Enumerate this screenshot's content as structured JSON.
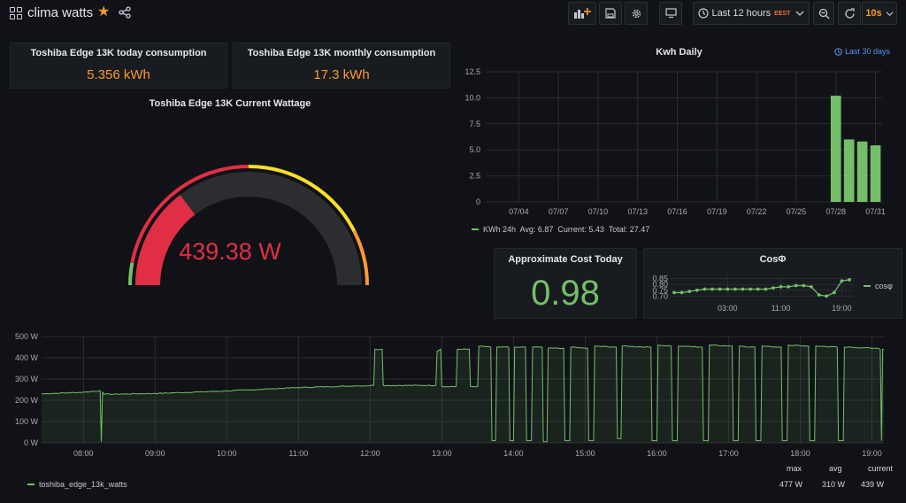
{
  "dashboard": {
    "title": "clima watts"
  },
  "toolbar": {
    "time_range": "Last 12 hours",
    "timezone": "EEST",
    "refresh_interval": "10s"
  },
  "panels": {
    "today": {
      "title": "Toshiba Edge 13K today consumption",
      "value": "5.356 kWh"
    },
    "monthly": {
      "title": "Toshiba Edge 13K monthly consumption",
      "value": "17.3 kWh"
    },
    "gauge": {
      "title": "Toshiba Edge 13K Current Wattage",
      "value": "439.38 W",
      "level": 439.38,
      "max": 1500
    },
    "kwh_daily": {
      "title": "Kwh Daily",
      "time_override": "Last 30 days",
      "legend": "KWh 24h  Avg: 6.87  Current: 5.43  Total: 27.47"
    },
    "cost": {
      "title": "Approximate Cost Today",
      "value": "0.98"
    },
    "cosphi": {
      "title": "CosΦ",
      "legend": "cosφ"
    },
    "watts": {
      "legend": "toshiba_edge_13k_watts",
      "stats_headers": [
        "max",
        "avg",
        "current"
      ],
      "stats_values": [
        "477 W",
        "310 W",
        "439 W"
      ]
    }
  },
  "colors": {
    "green": "#73bf69",
    "red": "#e02f44",
    "orange": "#ff9830",
    "yellow": "#fade2a",
    "blue": "#33a2e5"
  },
  "chart_data": [
    {
      "type": "bar",
      "title": "Kwh Daily",
      "categories": [
        "07/04",
        "07/07",
        "07/10",
        "07/13",
        "07/16",
        "07/19",
        "07/22",
        "07/25",
        "07/28",
        "07/31"
      ],
      "x_ticks": [
        "07/04",
        "07/07",
        "07/10",
        "07/13",
        "07/16",
        "07/19",
        "07/22",
        "07/25",
        "07/28",
        "07/31"
      ],
      "y_ticks": [
        "0",
        "2.5",
        "5.0",
        "7.5",
        "10.0",
        "12.5"
      ],
      "ylim": [
        0,
        12.5
      ],
      "series": [
        {
          "name": "KWh 24h",
          "dates": [
            "07/28",
            "07/29",
            "07/30",
            "07/31"
          ],
          "values": [
            10.2,
            6.0,
            5.8,
            5.43
          ]
        }
      ]
    },
    {
      "type": "line",
      "title": "CosΦ",
      "y_ticks": [
        "0.85",
        "0.80",
        "0.75",
        "0.70"
      ],
      "ylim": [
        0.68,
        0.87
      ],
      "x_ticks": [
        "03:00",
        "11:00",
        "19:00"
      ],
      "series": [
        {
          "name": "cosφ",
          "values": [
            0.73,
            0.73,
            0.74,
            0.75,
            0.76,
            0.76,
            0.76,
            0.76,
            0.76,
            0.76,
            0.76,
            0.76,
            0.76,
            0.77,
            0.78,
            0.78,
            0.79,
            0.79,
            0.78,
            0.71,
            0.7,
            0.73,
            0.83,
            0.84
          ]
        }
      ]
    },
    {
      "type": "area",
      "title": "",
      "y_ticks": [
        "0 W",
        "100 W",
        "200 W",
        "300 W",
        "400 W",
        "500 W"
      ],
      "ylim": [
        0,
        500
      ],
      "x_ticks": [
        "08:00",
        "09:00",
        "10:00",
        "11:00",
        "12:00",
        "13:00",
        "14:00",
        "15:00",
        "16:00",
        "17:00",
        "18:00",
        "19:00"
      ],
      "series": [
        {
          "name": "toshiba_edge_13k_watts",
          "points": [
            [
              "07:25",
              230
            ],
            [
              "08:00",
              238
            ],
            [
              "08:14",
              245
            ],
            [
              "08:15",
              5
            ],
            [
              "08:16",
              240
            ],
            [
              "08:17",
              228
            ],
            [
              "09:00",
              232
            ],
            [
              "10:00",
              244
            ],
            [
              "11:00",
              260
            ],
            [
              "11:50",
              268
            ],
            [
              "12:03",
              270
            ],
            [
              "12:04",
              440
            ],
            [
              "12:10",
              440
            ],
            [
              "12:11",
              270
            ],
            [
              "12:55",
              270
            ],
            [
              "12:56",
              430
            ],
            [
              "12:59",
              440
            ],
            [
              "13:00",
              265
            ],
            [
              "13:12",
              265
            ],
            [
              "13:13",
              440
            ],
            [
              "13:23",
              440
            ],
            [
              "13:24",
              265
            ],
            [
              "13:30",
              265
            ],
            [
              "13:31",
              455
            ],
            [
              "13:41",
              450
            ],
            [
              "13:42",
              10
            ],
            [
              "13:45",
              10
            ],
            [
              "13:46",
              450
            ],
            [
              "13:56",
              450
            ],
            [
              "13:57",
              10
            ],
            [
              "14:00",
              10
            ],
            [
              "14:01",
              450
            ],
            [
              "14:10",
              450
            ],
            [
              "14:11",
              10
            ],
            [
              "14:15",
              10
            ],
            [
              "14:16",
              450
            ],
            [
              "14:24",
              450
            ],
            [
              "14:25",
              5
            ],
            [
              "14:28",
              5
            ],
            [
              "14:29",
              445
            ],
            [
              "14:42",
              445
            ],
            [
              "14:43",
              10
            ],
            [
              "14:47",
              10
            ],
            [
              "14:48",
              450
            ],
            [
              "15:00",
              445
            ],
            [
              "15:02",
              445
            ],
            [
              "15:03",
              10
            ],
            [
              "15:07",
              10
            ],
            [
              "15:08",
              455
            ],
            [
              "15:26",
              450
            ],
            [
              "15:27",
              20
            ],
            [
              "15:30",
              20
            ],
            [
              "15:31",
              455
            ],
            [
              "15:55",
              450
            ],
            [
              "15:56",
              10
            ],
            [
              "16:00",
              10
            ],
            [
              "16:01",
              460
            ],
            [
              "16:12",
              455
            ],
            [
              "16:13",
              10
            ],
            [
              "16:17",
              10
            ],
            [
              "16:18",
              455
            ],
            [
              "16:38",
              450
            ],
            [
              "16:39",
              10
            ],
            [
              "16:43",
              10
            ],
            [
              "16:44",
              460
            ],
            [
              "17:03",
              455
            ],
            [
              "17:04",
              10
            ],
            [
              "17:08",
              10
            ],
            [
              "17:09",
              455
            ],
            [
              "17:22",
              450
            ],
            [
              "17:23",
              10
            ],
            [
              "17:27",
              10
            ],
            [
              "17:28",
              455
            ],
            [
              "17:44",
              450
            ],
            [
              "17:45",
              10
            ],
            [
              "17:49",
              10
            ],
            [
              "17:50",
              460
            ],
            [
              "18:07",
              455
            ],
            [
              "18:08",
              10
            ],
            [
              "18:12",
              10
            ],
            [
              "18:13",
              455
            ],
            [
              "18:31",
              450
            ],
            [
              "18:32",
              10
            ],
            [
              "18:36",
              10
            ],
            [
              "18:37",
              450
            ],
            [
              "19:05",
              445
            ],
            [
              "19:07",
              440
            ],
            [
              "19:08",
              10
            ],
            [
              "19:09",
              440
            ],
            [
              "19:10",
              439
            ]
          ]
        }
      ]
    }
  ]
}
